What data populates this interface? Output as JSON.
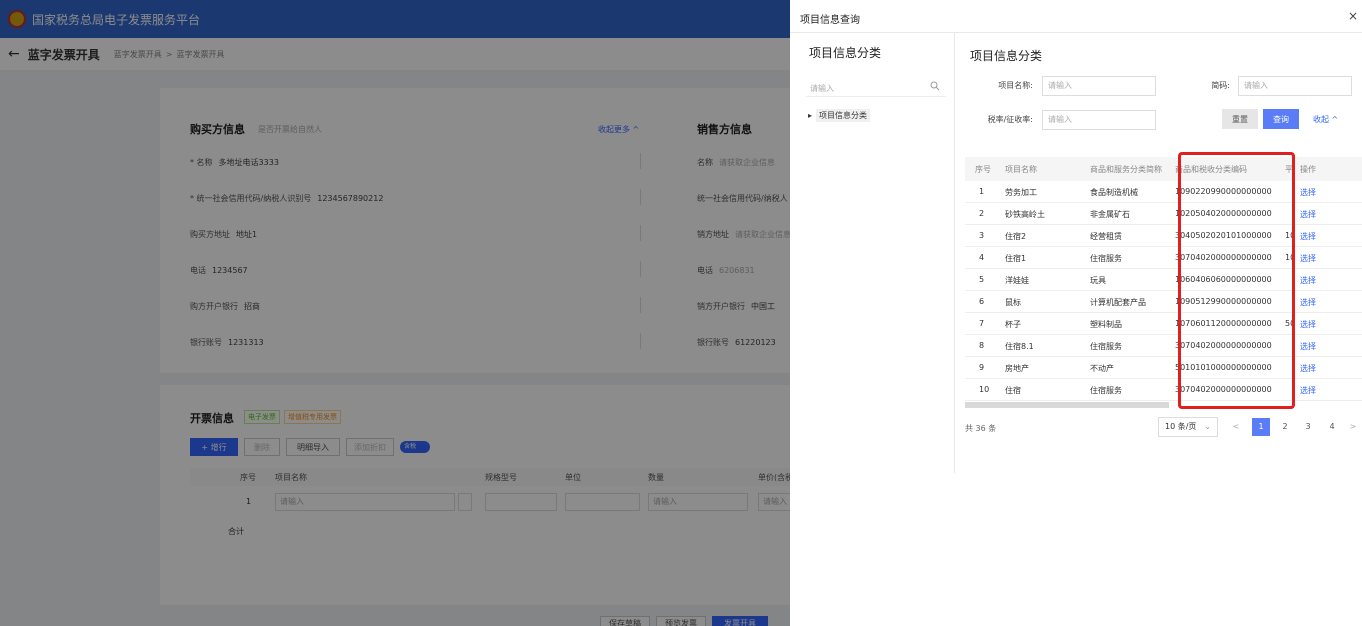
{
  "app": {
    "title": "国家税务总局电子发票服务平台"
  },
  "breadcrumb": {
    "back": "←",
    "title": "蓝字发票开具",
    "crumbs": [
      "蓝字发票开具",
      ">",
      "蓝字发票开具"
    ]
  },
  "buyer": {
    "title": "购买方信息",
    "natural_person": "是否开票给自然人",
    "collapse": "收起更多 ^",
    "name_label": "* 名称",
    "name_value": "多地址电话3333",
    "tax_label": "* 统一社会信用代码/纳税人识别号",
    "tax_value": "1234567890212",
    "addr_label": "购买方地址",
    "addr_value": "地址1",
    "phone_label": "电话",
    "phone_value": "1234567",
    "bank_label": "购方开户银行",
    "bank_value": "招商",
    "account_label": "银行账号",
    "account_value": "1231313"
  },
  "seller": {
    "title": "销售方信息",
    "name_label": "名称",
    "name_placeholder": "请获取企业信息",
    "tax_label": "统一社会信用代码/纳税人",
    "addr_label": "销方地址",
    "addr_placeholder": "请获取企业信息",
    "phone_label": "电话",
    "phone_value": "6206831",
    "bank_label": "销方开户银行",
    "bank_value": "中国工",
    "account_label": "银行账号",
    "account_value": "61220123"
  },
  "invoice": {
    "title": "开票信息",
    "tag1": "电子发票",
    "tag2": "增值税专用发票",
    "add_row": "+ 增行",
    "delete": "删除",
    "import": "明细导入",
    "split": "添加折扣",
    "toggle": "含税",
    "headers": [
      "序号",
      "项目名称",
      "规格型号",
      "单位",
      "数量",
      "单价(含税)"
    ],
    "row1_index": "1",
    "row_placeholder": "请输入",
    "total": "合计"
  },
  "footer": {
    "b1": "保存草稿",
    "b2": "预览发票",
    "b3": "发票开具"
  },
  "drawer": {
    "title": "项目信息查询",
    "close": "×",
    "left_title": "项目信息分类",
    "left_search_placeholder": "请输入",
    "tree_arrow": "▸",
    "tree_root": "项目信息分类",
    "right_title": "项目信息分类",
    "form": {
      "name_label": "项目名称:",
      "name_placeholder": "请输入",
      "short_label": "简码:",
      "short_placeholder": "请输入",
      "rate_label": "税率/征收率:",
      "rate_placeholder": "请输入",
      "reset": "重置",
      "query": "查询",
      "collapse": "收起 ^"
    },
    "table": {
      "headers": [
        "序号",
        "项目名称",
        "商品和服务分类简称",
        "商品和税收分类编码",
        "平台",
        "操作"
      ],
      "rows": [
        {
          "idx": "1",
          "name": "劳务加工",
          "cat": "食品制造机械",
          "code": "1090220990000000000",
          "extra": "",
          "op": "选择"
        },
        {
          "idx": "2",
          "name": "砂铁高岭土",
          "cat": "非金属矿石",
          "code": "1020504020000000000",
          "extra": "",
          "op": "选择"
        },
        {
          "idx": "3",
          "name": "住宿2",
          "cat": "经营租赁",
          "code": "3040502020101000000",
          "extra": "10",
          "op": "选择"
        },
        {
          "idx": "4",
          "name": "住宿1",
          "cat": "住宿服务",
          "code": "3070402000000000000",
          "extra": "10",
          "op": "选择"
        },
        {
          "idx": "5",
          "name": "洋娃娃",
          "cat": "玩具",
          "code": "1060406060000000000",
          "extra": "",
          "op": "选择"
        },
        {
          "idx": "6",
          "name": "鼠标",
          "cat": "计算机配套产品",
          "code": "1090512990000000000",
          "extra": "",
          "op": "选择"
        },
        {
          "idx": "7",
          "name": "杯子",
          "cat": "塑料制品",
          "code": "1070601120000000000",
          "extra": "50",
          "op": "选择"
        },
        {
          "idx": "8",
          "name": "住宿8.1",
          "cat": "住宿服务",
          "code": "3070402000000000000",
          "extra": "",
          "op": "选择"
        },
        {
          "idx": "9",
          "name": "房地产",
          "cat": "不动产",
          "code": "5010101000000000000",
          "extra": "",
          "op": "选择"
        },
        {
          "idx": "10",
          "name": "住宿",
          "cat": "住宿服务",
          "code": "3070402000000000000",
          "extra": "",
          "op": "选择"
        }
      ]
    },
    "pagination": {
      "total": "共 36 条",
      "page_size": "10 条/页",
      "prev": "<",
      "next": ">",
      "pages": [
        "1",
        "2",
        "3",
        "4"
      ]
    }
  },
  "colors": {
    "accent": "#5b7cf7",
    "highlight": "#e02020",
    "header": "#3366cc"
  }
}
